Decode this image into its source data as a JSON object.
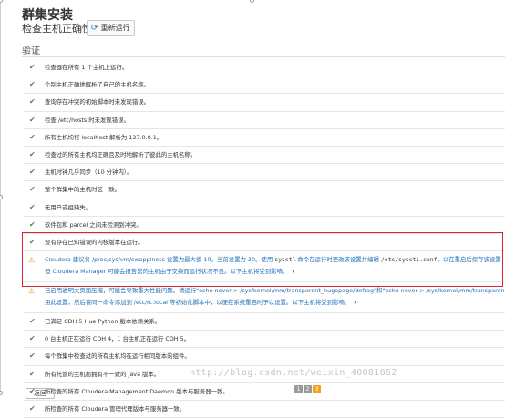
{
  "header": {
    "title": "群集安装",
    "subtitle": "检查主机正确性",
    "rerun_label": "重新运行"
  },
  "section_title": "验证",
  "checks_top": [
    "检查器在所有 1 个主机上运行。",
    "个别主机正确地解析了自己的主机名称。",
    "查询存在冲突的初始脚本时未发现错误。",
    "检查 /etc/hosts 时未发现错误。",
    "所有主机均将 localhost 解析为 127.0.0.1。",
    "检查过的所有主机均正确且及时地解析了彼此的主机名称。",
    "主机时钟几乎同步（10 分钟内）。",
    "整个群集中的主机时区一致。",
    "无用户或组缺失。",
    "软件包和 parcel 之间未检测到冲突。",
    "没有存在已知错误的内核版本在运行。"
  ],
  "warnings": [
    {
      "line1_a": "Cloudera 建议将 /proc/sys/vm/swappiness 设置为最大值 10。当前设置为 30。使用 ",
      "line1_mono1": "sysctl",
      "line1_b": " 命令在运行时更改该设置并编辑 ",
      "line1_mono2": "/etc/sysctl.conf",
      "line1_c": "，以在重启后保存该设置",
      "line2": "但 Cloudera Manager 可能会报告您的主机由于交换而运行状况不良。以下主机将受到影响：",
      "line3": ""
    },
    {
      "line1_a": "已启用透明大页面压缩，可能会导致重大性能问题。请运行\"echo never > /sys/kernel/mm/transparent_hugepage/defrag\"和\"echo never > /sys/kernel/mm/transparent",
      "line1_mono1": "",
      "line1_b": "",
      "line1_mono2": "",
      "line1_c": "",
      "line2": "用此设置，然后将同一命令添加到 /etc/rc.local 等初始化脚本中，以便在系统重启时予以设置。以下主机将受到影响：",
      "line3": ""
    }
  ],
  "checks_bottom": [
    "已满足 CDH 5 Hue Python 版本依赖关系。",
    "0 台主机正在运行 CDH 4，1 台主机正在运行 CDH 5。",
    "每个群集中检查过的所有主机均在运行相同版本的组件。",
    "所有托管的主机都拥有不一致的 Java 版本。",
    "所检查的所有 Cloudera Management Daemon 版本与服务器一致。",
    "所检查的所有 Cloudera 管理代理版本与服务器一致。"
  ],
  "footer": {
    "back_label": "返回",
    "pages": [
      "1",
      "2",
      "3"
    ],
    "active_page": "3",
    "watermark": "http://blog.csdn.net/weixin_40081862"
  },
  "colors": {
    "link_blue": "#1a6db7",
    "check_green": "#3a9a3a",
    "warn_orange": "#e08c1a",
    "highlight_red": "#d9232e"
  }
}
